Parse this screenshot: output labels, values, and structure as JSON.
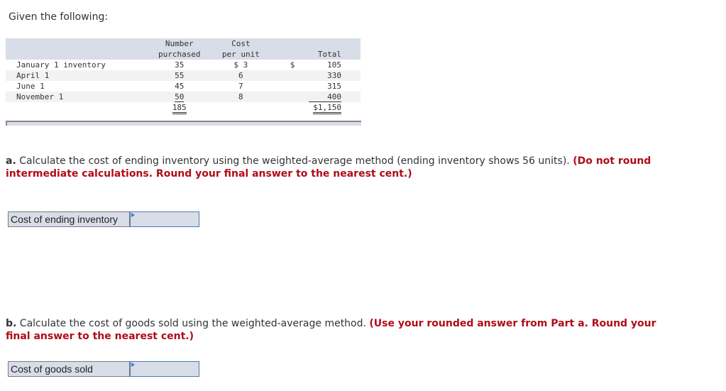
{
  "intro": "Given the following:",
  "table": {
    "headers": {
      "number_line1": "Number",
      "number_line2": "purchased",
      "cost_line1": "Cost",
      "cost_line2": "per unit",
      "total": "Total"
    },
    "rows": [
      {
        "label": "January 1 inventory",
        "number": "35",
        "cost": "$ 3",
        "total_prefix": "$",
        "total": "105"
      },
      {
        "label": "April 1",
        "number": "55",
        "cost": "6",
        "total_prefix": "",
        "total": "330"
      },
      {
        "label": "June 1",
        "number": "45",
        "cost": "7",
        "total_prefix": "",
        "total": "315"
      },
      {
        "label": "November 1",
        "number": "50",
        "cost": "8",
        "total_prefix": "",
        "total": "400"
      }
    ],
    "totals": {
      "number": "185",
      "total": "$1,150"
    }
  },
  "part_a": {
    "letter": "a.",
    "text": " Calculate the cost of ending inventory using the weighted-average method (ending inventory shows 56 units). ",
    "instruction": "(Do not round intermediate calculations. Round your final answer to the nearest cent.)",
    "answer_label": "Cost of ending inventory",
    "answer_value": ""
  },
  "part_b": {
    "letter": "b.",
    "text": " Calculate the cost of goods sold using the weighted-average method. ",
    "instruction": "(Use your rounded answer from Part a. Round your final answer to the nearest cent.)",
    "answer_label": "Cost of goods sold",
    "answer_value": ""
  },
  "colors": {
    "instruction_red": "#b00c18",
    "header_bg": "#d8dde8",
    "input_border": "#4a79b4"
  }
}
